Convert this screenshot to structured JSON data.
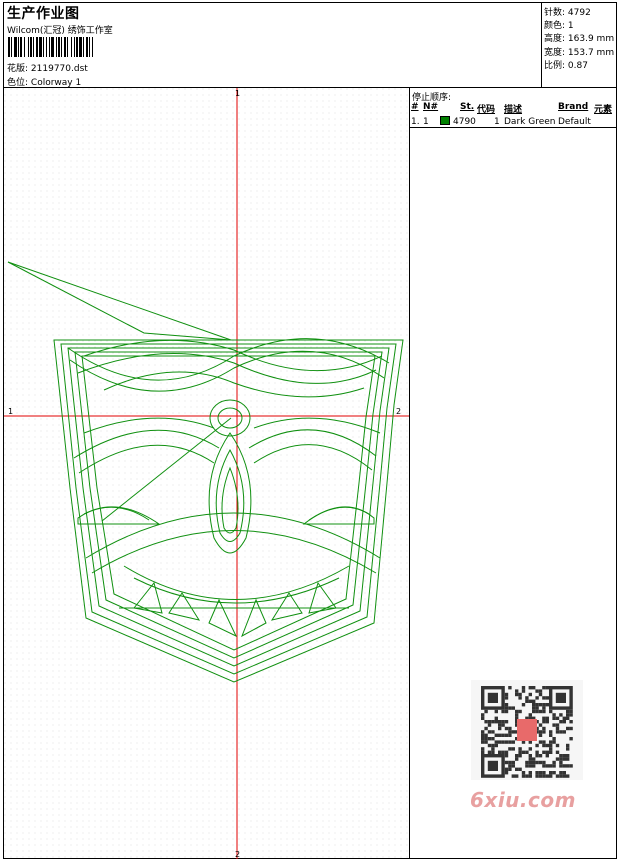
{
  "header": {
    "title": "生产作业图",
    "studio": "Wilcom(汇冠) 绣饰工作室",
    "design_label": "花版:",
    "design_value": "2119770.dst",
    "color_label": "色位:",
    "color_value": "Colorway 1"
  },
  "info": {
    "stitches_label": "针数:",
    "stitches_value": "4792",
    "colors_label": "颜色:",
    "colors_value": "1",
    "height_label": "高度:",
    "height_value": "163.9 mm",
    "width_label": "宽度:",
    "width_value": "153.7 mm",
    "scale_label": "比例:",
    "scale_value": "0.87"
  },
  "stop_sequence": {
    "title": "停止顺序:",
    "columns": [
      "#",
      "N#",
      "St.",
      "代码",
      "描述",
      "Brand",
      "元素"
    ],
    "rows": [
      {
        "num": "1.",
        "n": "1",
        "stitches": "4790",
        "code": "1",
        "description": "Dark Green",
        "brand": "Default",
        "swatch_color": "#008000"
      }
    ]
  },
  "plot": {
    "axis_labels": {
      "top": "1",
      "bottom": "2",
      "left": "1",
      "right": "2"
    },
    "thread_color": "#109010",
    "axis_color": "#e00000"
  },
  "watermark": {
    "text": "6xiu.com"
  }
}
